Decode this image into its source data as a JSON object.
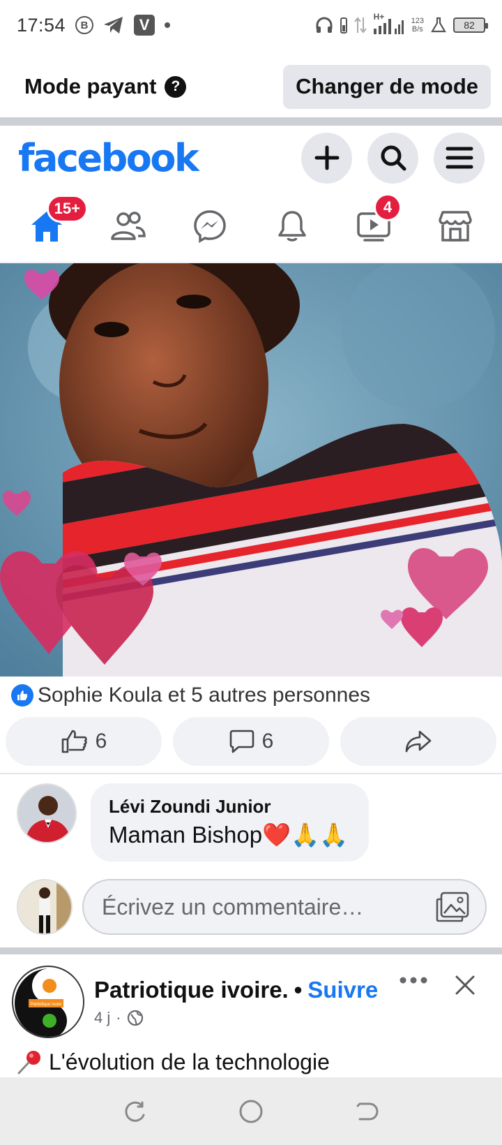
{
  "status_bar": {
    "time": "17:54",
    "b_icon": "B",
    "v_icon": "V",
    "network_type": "H+",
    "speed_value": "123",
    "speed_unit": "B/s",
    "battery": "82"
  },
  "mode_bar": {
    "title": "Mode payant",
    "help_icon": "?",
    "change_button": "Changer de mode"
  },
  "header": {
    "logo": "facebook",
    "icons": [
      "plus-icon",
      "search-icon",
      "menu-icon"
    ]
  },
  "nav_tabs": {
    "home_badge": "15+",
    "video_badge": "4",
    "tabs": [
      "home",
      "friends",
      "messenger",
      "notifications",
      "video",
      "marketplace"
    ]
  },
  "post": {
    "reactions_text": "Sophie Koula et 5 autres personnes",
    "like_count": "6",
    "comment_count": "6"
  },
  "comment": {
    "author": "Lévi Zoundi Junior",
    "text": "Maman Bishop❤️🙏🙏"
  },
  "comment_input": {
    "placeholder": "Écrivez un commentaire…"
  },
  "next_post": {
    "page_name": "Patriotique ivoire.",
    "separator": "•",
    "follow": "Suivre",
    "time": "4 j",
    "time_sep": "·",
    "text": "L'évolution de la technologie",
    "avatar_label": "Patriotique ivoire"
  },
  "colors": {
    "facebook_blue": "#1877f2",
    "badge_red": "#e41e3f",
    "gray_bg": "#e4e6eb"
  }
}
